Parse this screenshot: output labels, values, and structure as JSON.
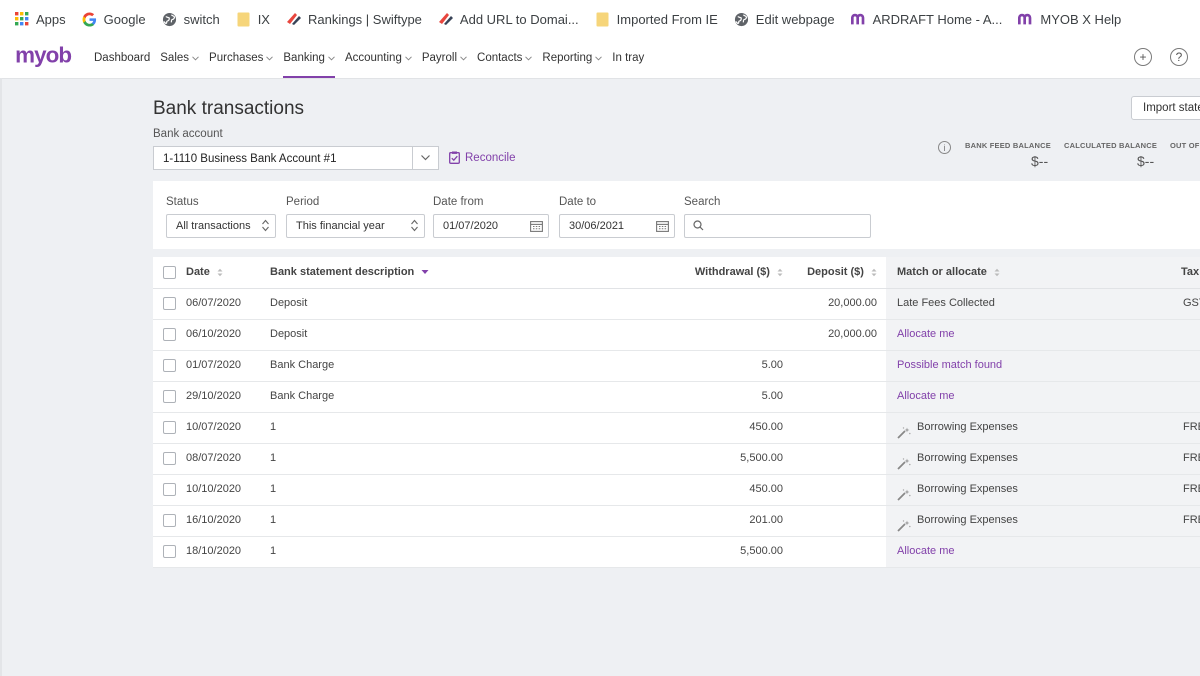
{
  "bookmarks": [
    {
      "label": "Apps",
      "icon": "apps-grid-icon"
    },
    {
      "label": "Google",
      "icon": "google-icon"
    },
    {
      "label": "switch",
      "icon": "globe-icon"
    },
    {
      "label": "IX",
      "icon": "folder-icon"
    },
    {
      "label": "Rankings | Swiftype",
      "icon": "swiftype-icon"
    },
    {
      "label": "Add URL to Domai...",
      "icon": "swiftype-icon"
    },
    {
      "label": "Imported From IE",
      "icon": "folder-icon"
    },
    {
      "label": "Edit webpage",
      "icon": "globe-icon"
    },
    {
      "label": "ARDRAFT Home - A...",
      "icon": "myob-m-icon"
    },
    {
      "label": "MYOB X Help",
      "icon": "myob-m-icon"
    }
  ],
  "nav": {
    "logo": "myob",
    "items": [
      {
        "label": "Dashboard",
        "dropdown": false
      },
      {
        "label": "Sales",
        "dropdown": true
      },
      {
        "label": "Purchases",
        "dropdown": true
      },
      {
        "label": "Banking",
        "dropdown": true,
        "active": true
      },
      {
        "label": "Accounting",
        "dropdown": true
      },
      {
        "label": "Payroll",
        "dropdown": true
      },
      {
        "label": "Contacts",
        "dropdown": true
      },
      {
        "label": "Reporting",
        "dropdown": true
      },
      {
        "label": "In tray",
        "dropdown": false
      }
    ]
  },
  "page": {
    "title": "Bank transactions",
    "account_label": "Bank account",
    "account_value": "1-1110 Business Bank Account #1",
    "reconcile_label": "Reconcile",
    "import_label": "Import state"
  },
  "balances": {
    "bank_feed_label": "BANK FEED BALANCE",
    "bank_feed_value": "$--",
    "calculated_label": "CALCULATED BALANCE",
    "calculated_value": "$--",
    "out_of_label": "OUT OF"
  },
  "filters": {
    "status_label": "Status",
    "status_value": "All transactions",
    "period_label": "Period",
    "period_value": "This financial year",
    "date_from_label": "Date from",
    "date_from_value": "01/07/2020",
    "date_to_label": "Date to",
    "date_to_value": "30/06/2021",
    "search_label": "Search",
    "search_value": ""
  },
  "table": {
    "headers": {
      "date": "Date",
      "description": "Bank statement description",
      "withdrawal": "Withdrawal ($)",
      "deposit": "Deposit ($)",
      "match": "Match or allocate",
      "tax": "Tax"
    },
    "rows": [
      {
        "date": "06/07/2020",
        "description": "Deposit",
        "withdrawal": "",
        "deposit": "20,000.00",
        "match": "Late Fees Collected",
        "match_type": "text",
        "tax": "GST"
      },
      {
        "date": "06/10/2020",
        "description": "Deposit",
        "withdrawal": "",
        "deposit": "20,000.00",
        "match": "Allocate me",
        "match_type": "link",
        "tax": ""
      },
      {
        "date": "01/07/2020",
        "description": "Bank Charge",
        "withdrawal": "5.00",
        "deposit": "",
        "match": "Possible match found",
        "match_type": "link",
        "tax": ""
      },
      {
        "date": "29/10/2020",
        "description": "Bank Charge",
        "withdrawal": "5.00",
        "deposit": "",
        "match": "Allocate me",
        "match_type": "link",
        "tax": ""
      },
      {
        "date": "10/07/2020",
        "description": "1",
        "withdrawal": "450.00",
        "deposit": "",
        "match": "Borrowing Expenses",
        "match_type": "rule",
        "tax": "FRE"
      },
      {
        "date": "08/07/2020",
        "description": "1",
        "withdrawal": "5,500.00",
        "deposit": "",
        "match": "Borrowing Expenses",
        "match_type": "rule",
        "tax": "FRE"
      },
      {
        "date": "10/10/2020",
        "description": "1",
        "withdrawal": "450.00",
        "deposit": "",
        "match": "Borrowing Expenses",
        "match_type": "rule",
        "tax": "FRE"
      },
      {
        "date": "16/10/2020",
        "description": "1",
        "withdrawal": "201.00",
        "deposit": "",
        "match": "Borrowing Expenses",
        "match_type": "rule",
        "tax": "FRE"
      },
      {
        "date": "18/10/2020",
        "description": "1",
        "withdrawal": "5,500.00",
        "deposit": "",
        "match": "Allocate me",
        "match_type": "link",
        "tax": ""
      }
    ]
  },
  "colors": {
    "brand": "#8241aa",
    "background": "#eef0f3"
  }
}
